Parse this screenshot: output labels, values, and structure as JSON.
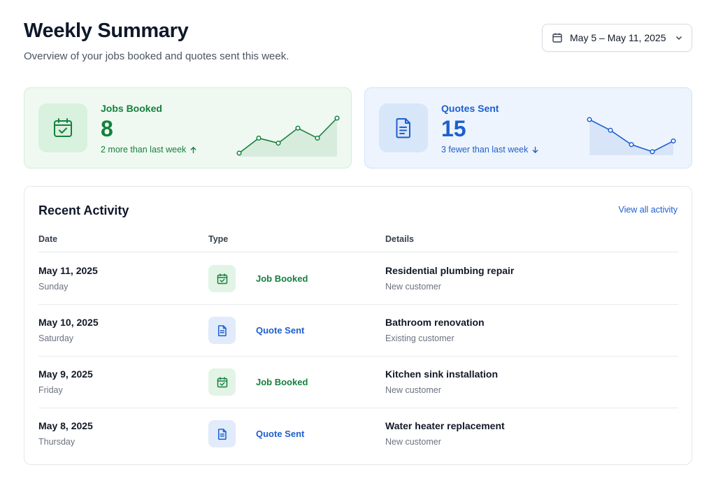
{
  "header": {
    "title": "Weekly Summary",
    "subtitle": "Overview of your jobs booked and quotes sent this week.",
    "date_range": "May 5 – May 11, 2025"
  },
  "stats": {
    "jobs": {
      "label": "Jobs Booked",
      "value": "8",
      "note": "2 more than last week",
      "trend": "up",
      "color": "#15803d",
      "icon": "calendar-check-icon",
      "sparkline": [
        2,
        5,
        4,
        7,
        5,
        9
      ]
    },
    "quotes": {
      "label": "Quotes Sent",
      "value": "15",
      "note": "3 fewer than last week",
      "trend": "down",
      "color": "#1d5fcf",
      "icon": "document-icon",
      "sparkline": [
        8,
        6.5,
        4.5,
        3.5,
        5
      ]
    }
  },
  "activity": {
    "title": "Recent Activity",
    "view_all": "View all activity",
    "columns": {
      "date": "Date",
      "type": "Type",
      "details": "Details"
    },
    "rows": [
      {
        "date": "May 11, 2025",
        "day": "Sunday",
        "type": "Job Booked",
        "kind": "job",
        "detail": "Residential plumbing repair",
        "sub": "New customer"
      },
      {
        "date": "May 10, 2025",
        "day": "Saturday",
        "type": "Quote Sent",
        "kind": "quote",
        "detail": "Bathroom renovation",
        "sub": "Existing customer"
      },
      {
        "date": "May 9, 2025",
        "day": "Friday",
        "type": "Job Booked",
        "kind": "job",
        "detail": "Kitchen sink installation",
        "sub": "New customer"
      },
      {
        "date": "May 8, 2025",
        "day": "Thursday",
        "type": "Quote Sent",
        "kind": "quote",
        "detail": "Water heater replacement",
        "sub": "New customer"
      }
    ]
  },
  "colors": {
    "green": "#15803d",
    "blue": "#1d5fcf"
  }
}
